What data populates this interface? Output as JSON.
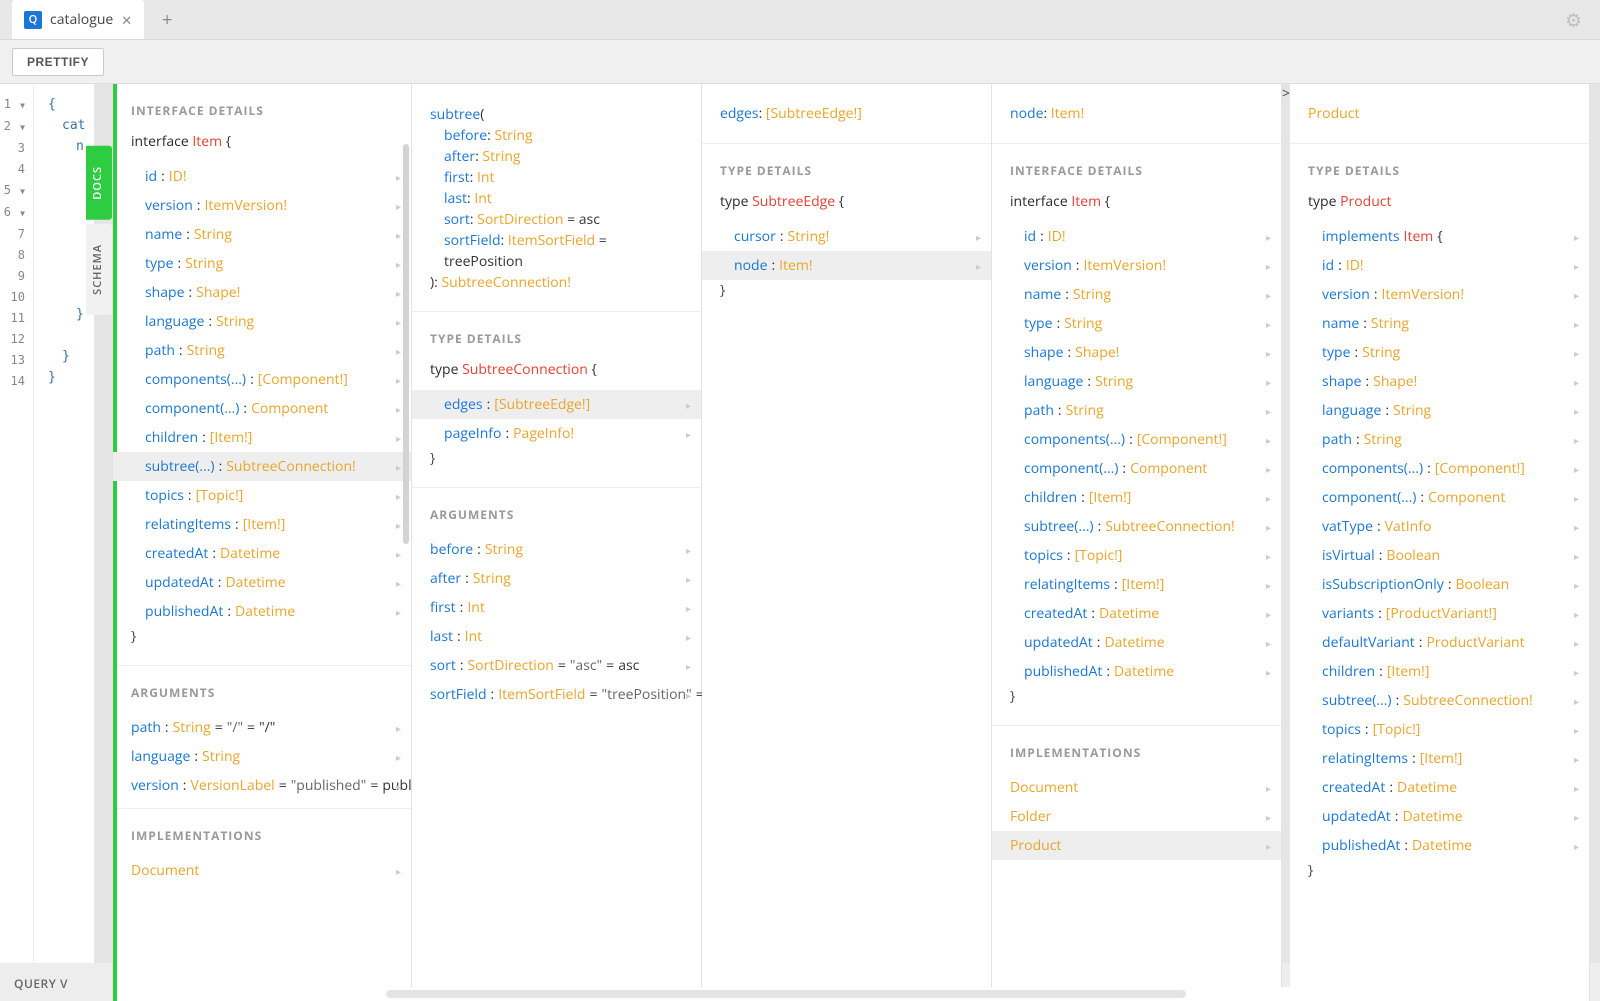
{
  "tab": {
    "icon_letter": "Q",
    "title": "catalogue"
  },
  "toolbar": {
    "prettify": "PRETTIFY"
  },
  "rail": {
    "docs": "DOCS",
    "schema": "SCHEMA"
  },
  "query_variables": "QUERY V",
  "linenumbers": [
    "1",
    "2",
    "3",
    "4",
    "5",
    "6",
    "7",
    "8",
    "9",
    "10",
    "11",
    "12",
    "13",
    "14"
  ],
  "editor_snippet": [
    "{",
    "cat",
    "n",
    "",
    "",
    "",
    "",
    "",
    "",
    "",
    "}",
    "",
    "}",
    "}"
  ],
  "panel0": {
    "h1": "INTERFACE DETAILS",
    "head_kw": "interface",
    "head_name": "Item",
    "fields": [
      {
        "f": "id",
        "t": "ID!"
      },
      {
        "f": "version",
        "t": "ItemVersion!"
      },
      {
        "f": "name",
        "t": "String"
      },
      {
        "f": "type",
        "t": "String"
      },
      {
        "f": "shape",
        "t": "Shape!"
      },
      {
        "f": "language",
        "t": "String"
      },
      {
        "f": "path",
        "t": "String"
      },
      {
        "f": "components(...)",
        "t": "[Component!]"
      },
      {
        "f": "component(...)",
        "t": "Component"
      },
      {
        "f": "children",
        "t": "[Item!]"
      },
      {
        "f": "subtree(...)",
        "t": "SubtreeConnection!",
        "selected": true
      },
      {
        "f": "topics",
        "t": "[Topic!]"
      },
      {
        "f": "relatingItems",
        "t": "[Item!]"
      },
      {
        "f": "createdAt",
        "t": "Datetime"
      },
      {
        "f": "updatedAt",
        "t": "Datetime"
      },
      {
        "f": "publishedAt",
        "t": "Datetime"
      }
    ],
    "h2": "ARGUMENTS",
    "args": [
      {
        "f": "path",
        "t": "String",
        "d": "\"/\"",
        "dv": "\"/\""
      },
      {
        "f": "language",
        "t": "String"
      },
      {
        "f": "version",
        "t": "VersionLabel",
        "d": "\"published\"",
        "dv": "published"
      }
    ],
    "h3": "IMPLEMENTATIONS",
    "impls": [
      {
        "t": "Document"
      }
    ]
  },
  "panel1": {
    "sig_field": "subtree",
    "sig_params": [
      {
        "f": "before",
        "t": "String"
      },
      {
        "f": "after",
        "t": "String"
      },
      {
        "f": "first",
        "t": "Int"
      },
      {
        "f": "last",
        "t": "Int"
      },
      {
        "f": "sort",
        "t": "SortDirection",
        "d": "asc"
      },
      {
        "f": "sortField",
        "t": "ItemSortField",
        "d": "treePosition"
      }
    ],
    "sig_return": "SubtreeConnection!",
    "h2": "TYPE DETAILS",
    "type_kw": "type",
    "type_name": "SubtreeConnection",
    "fields": [
      {
        "f": "edges",
        "t": "[SubtreeEdge!]",
        "selected": true
      },
      {
        "f": "pageInfo",
        "t": "PageInfo!"
      }
    ],
    "h3": "ARGUMENTS",
    "args": [
      {
        "f": "before",
        "t": "String"
      },
      {
        "f": "after",
        "t": "String"
      },
      {
        "f": "first",
        "t": "Int"
      },
      {
        "f": "last",
        "t": "Int"
      },
      {
        "f": "sort",
        "t": "SortDirection",
        "d": "\"asc\"",
        "dv": "asc"
      },
      {
        "f": "sortField",
        "t": "ItemSortField",
        "d": "\"treePosition\"",
        "dv": "treePosition"
      }
    ]
  },
  "panel2": {
    "title_f": "edges",
    "title_t": "[SubtreeEdge!]",
    "h2": "TYPE DETAILS",
    "type_kw": "type",
    "type_name": "SubtreeEdge",
    "fields": [
      {
        "f": "cursor",
        "t": "String!"
      },
      {
        "f": "node",
        "t": "Item!",
        "selected": true
      }
    ]
  },
  "panel3": {
    "title_f": "node",
    "title_t": "Item!",
    "h2": "INTERFACE DETAILS",
    "head_kw": "interface",
    "head_name": "Item",
    "fields": [
      {
        "f": "id",
        "t": "ID!"
      },
      {
        "f": "version",
        "t": "ItemVersion!"
      },
      {
        "f": "name",
        "t": "String"
      },
      {
        "f": "type",
        "t": "String"
      },
      {
        "f": "shape",
        "t": "Shape!"
      },
      {
        "f": "language",
        "t": "String"
      },
      {
        "f": "path",
        "t": "String"
      },
      {
        "f": "components(...)",
        "t": "[Component!]"
      },
      {
        "f": "component(...)",
        "t": "Component"
      },
      {
        "f": "children",
        "t": "[Item!]"
      },
      {
        "f": "subtree(...)",
        "t": "SubtreeConnection!"
      },
      {
        "f": "topics",
        "t": "[Topic!]"
      },
      {
        "f": "relatingItems",
        "t": "[Item!]"
      },
      {
        "f": "createdAt",
        "t": "Datetime"
      },
      {
        "f": "updatedAt",
        "t": "Datetime"
      },
      {
        "f": "publishedAt",
        "t": "Datetime"
      }
    ],
    "h3": "IMPLEMENTATIONS",
    "impls": [
      {
        "t": "Document"
      },
      {
        "t": "Folder"
      },
      {
        "t": "Product",
        "selected": true
      }
    ]
  },
  "panel4": {
    "title_t": "Product",
    "h2": "TYPE DETAILS",
    "type_kw": "type",
    "type_name": "Product",
    "impl_kw": "implements",
    "impl_name": "Item",
    "fields": [
      {
        "f": "id",
        "t": "ID!"
      },
      {
        "f": "version",
        "t": "ItemVersion!"
      },
      {
        "f": "name",
        "t": "String"
      },
      {
        "f": "type",
        "t": "String"
      },
      {
        "f": "shape",
        "t": "Shape!"
      },
      {
        "f": "language",
        "t": "String"
      },
      {
        "f": "path",
        "t": "String"
      },
      {
        "f": "components(...)",
        "t": "[Component!]"
      },
      {
        "f": "component(...)",
        "t": "Component"
      },
      {
        "f": "vatType",
        "t": "VatInfo"
      },
      {
        "f": "isVirtual",
        "t": "Boolean"
      },
      {
        "f": "isSubscriptionOnly",
        "t": "Boolean"
      },
      {
        "f": "variants",
        "t": "[ProductVariant!]"
      },
      {
        "f": "defaultVariant",
        "t": "ProductVariant"
      },
      {
        "f": "children",
        "t": "[Item!]"
      },
      {
        "f": "subtree(...)",
        "t": "SubtreeConnection!"
      },
      {
        "f": "topics",
        "t": "[Topic!]"
      },
      {
        "f": "relatingItems",
        "t": "[Item!]"
      },
      {
        "f": "createdAt",
        "t": "Datetime"
      },
      {
        "f": "updatedAt",
        "t": "Datetime"
      },
      {
        "f": "publishedAt",
        "t": "Datetime"
      }
    ]
  }
}
